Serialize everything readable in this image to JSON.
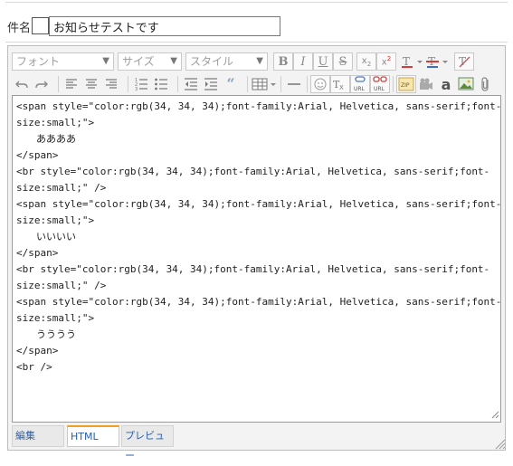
{
  "subject": {
    "label": "件名",
    "value": "お知らせテストです"
  },
  "toolbar": {
    "font_select": "フォント",
    "size_select": "サイズ",
    "style_select": "スタイル",
    "url_label": "URL",
    "zip_label": "ZIP",
    "a_label": "a"
  },
  "code_lines": [
    {
      "text": "<span style=\"color:rgb(34, 34, 34);font-family:Arial, Helvetica, sans-serif;font-",
      "indent": false
    },
    {
      "text": "size:small;\">",
      "indent": false
    },
    {
      "text": "ああああ",
      "indent": true
    },
    {
      "text": "</span>",
      "indent": false
    },
    {
      "text": "<br style=\"color:rgb(34, 34, 34);font-family:Arial, Helvetica, sans-serif;font-",
      "indent": false
    },
    {
      "text": "size:small;\" />",
      "indent": false
    },
    {
      "text": "<span style=\"color:rgb(34, 34, 34);font-family:Arial, Helvetica, sans-serif;font-",
      "indent": false
    },
    {
      "text": "size:small;\">",
      "indent": false
    },
    {
      "text": "いいいい",
      "indent": true
    },
    {
      "text": "</span>",
      "indent": false
    },
    {
      "text": "<br style=\"color:rgb(34, 34, 34);font-family:Arial, Helvetica, sans-serif;font-",
      "indent": false
    },
    {
      "text": "size:small;\" />",
      "indent": false
    },
    {
      "text": "<span style=\"color:rgb(34, 34, 34);font-family:Arial, Helvetica, sans-serif;font-",
      "indent": false
    },
    {
      "text": "size:small;\">",
      "indent": false
    },
    {
      "text": "うううう",
      "indent": true
    },
    {
      "text": "</span>",
      "indent": false
    },
    {
      "text": "<br />",
      "indent": false
    }
  ],
  "tabs": {
    "edit": "編集",
    "html": "HTML",
    "preview": "プレビュー"
  },
  "colors": {
    "active_tab_accent": "#f0a020",
    "tab_text": "#2a5fa8"
  },
  "icons": [
    "bold-icon",
    "italic-icon",
    "underline-icon",
    "strikethrough-icon",
    "subscript-icon",
    "superscript-icon",
    "text-color-icon",
    "background-color-icon",
    "clear-format-icon",
    "undo-icon",
    "redo-icon",
    "align-left-icon",
    "align-center-icon",
    "align-right-icon",
    "ordered-list-icon",
    "unordered-list-icon",
    "outdent-icon",
    "indent-icon",
    "blockquote-icon",
    "table-icon",
    "horizontal-rule-icon",
    "emoji-icon",
    "clean-code-icon",
    "insert-link-icon",
    "unlink-icon",
    "zip-icon",
    "video-icon",
    "font-a-icon",
    "image-icon",
    "attachment-icon",
    "resize-grip-icon"
  ]
}
